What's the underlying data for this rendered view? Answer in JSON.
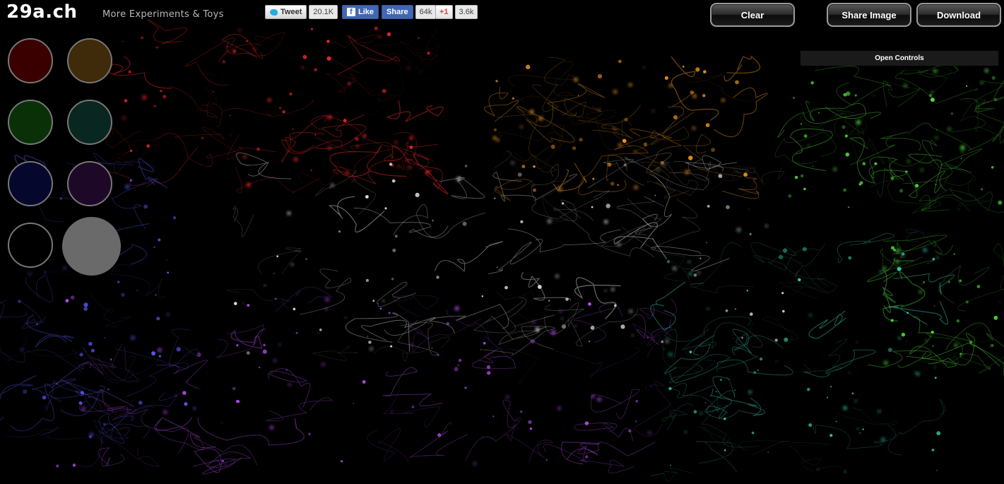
{
  "header": {
    "logo": "29a.ch",
    "tagline": "More Experiments & Toys"
  },
  "social": {
    "tweet_label": "Tweet",
    "tweet_count": "20.1K",
    "fb_like_label": "Like",
    "fb_share_label": "Share",
    "fb_count": "64k",
    "gplus_label": "+1",
    "gplus_count": "3.6k"
  },
  "toolbar": {
    "clear_label": "Clear",
    "share_image_label": "Share Image",
    "download_label": "Download"
  },
  "controls": {
    "open_controls_label": "Open Controls"
  },
  "palette": {
    "swatches": [
      {
        "name": "red",
        "color": "#3a0000"
      },
      {
        "name": "orange",
        "color": "#3f2a0a"
      },
      {
        "name": "green",
        "color": "#0a3008"
      },
      {
        "name": "teal",
        "color": "#0a2620"
      },
      {
        "name": "blue",
        "color": "#06072c"
      },
      {
        "name": "purple",
        "color": "#1e0828"
      },
      {
        "name": "black",
        "color": "#000000"
      },
      {
        "name": "white",
        "color": "#6a6a6a"
      }
    ],
    "selected": "white"
  },
  "clusters": [
    {
      "name": "red",
      "color": "#ff2a2a"
    },
    {
      "name": "orange",
      "color": "#ffa020"
    },
    {
      "name": "green",
      "color": "#55e040"
    },
    {
      "name": "white",
      "color": "#e8e8e8"
    },
    {
      "name": "blue",
      "color": "#5a5aff"
    },
    {
      "name": "purple",
      "color": "#c050ff"
    },
    {
      "name": "teal",
      "color": "#40e0c0"
    }
  ]
}
